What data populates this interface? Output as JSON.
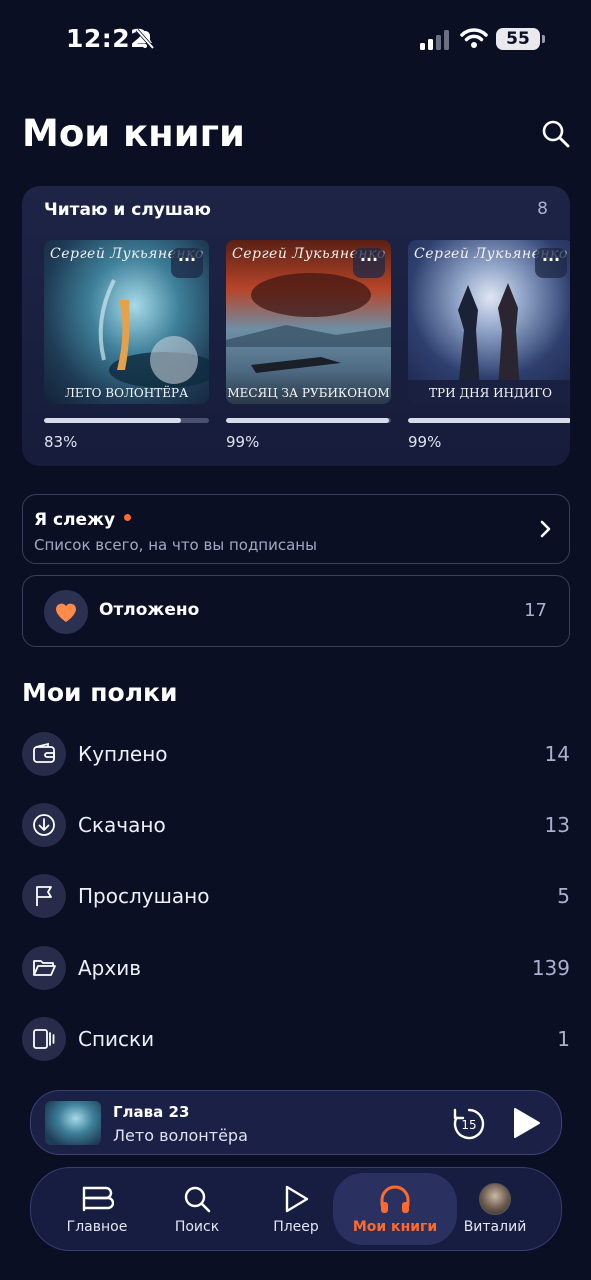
{
  "status_bar": {
    "time": "12:22",
    "battery": "55"
  },
  "header": {
    "title": "Мои книги"
  },
  "reading": {
    "title": "Читаю и слушаю",
    "count": "8",
    "books": [
      {
        "author": "Сергей Лукьяненко",
        "title": "Лето волонтёра",
        "progress": 0.83,
        "progress_label": "83%"
      },
      {
        "author": "Сергей Лукьяненко",
        "title": "Месяц за Рубиконом",
        "progress": 0.99,
        "progress_label": "99%"
      },
      {
        "author": "Сергей Лукьяненко",
        "title": "Три дня Индиго",
        "progress": 0.99,
        "progress_label": "99%"
      }
    ],
    "more_label": "···"
  },
  "follow": {
    "label": "Я слежу",
    "subtitle": "Список всего, на что вы подписаны"
  },
  "deferred": {
    "label": "Отложено",
    "count": "17"
  },
  "shelves": {
    "title": "Мои полки",
    "items": [
      {
        "label": "Куплено",
        "count": "14",
        "icon": "wallet-icon"
      },
      {
        "label": "Скачано",
        "count": "13",
        "icon": "download-icon"
      },
      {
        "label": "Прослушано",
        "count": "5",
        "icon": "flag-icon"
      },
      {
        "label": "Архив",
        "count": "139",
        "icon": "folder-icon"
      },
      {
        "label": "Списки",
        "count": "1",
        "icon": "list-icon"
      }
    ]
  },
  "player": {
    "chapter": "Глава 23",
    "book": "Лето волонтёра",
    "rewind": "15"
  },
  "tabs": [
    {
      "label": "Главное",
      "icon": "home-icon"
    },
    {
      "label": "Поиск",
      "icon": "search-icon"
    },
    {
      "label": "Плеер",
      "icon": "play-icon"
    },
    {
      "label": "Мои книги",
      "icon": "headphones-icon",
      "active": true
    },
    {
      "label": "Виталий",
      "icon": "avatar"
    }
  ],
  "colors": {
    "accent": "#ff6a2b",
    "background": "#0b0f24"
  }
}
